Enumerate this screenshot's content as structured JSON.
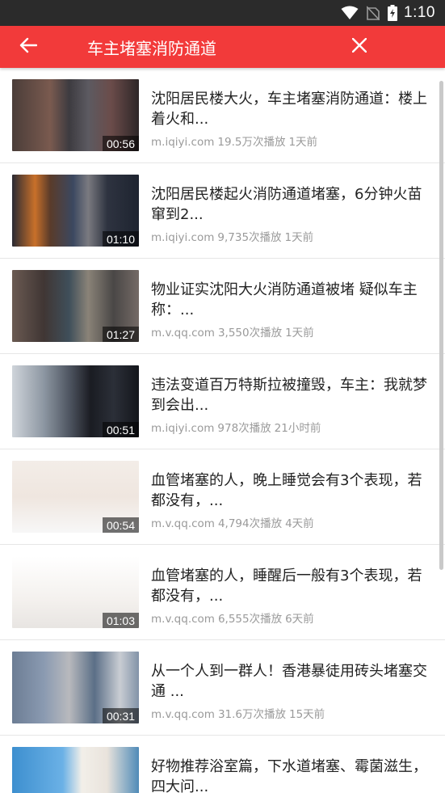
{
  "status_bar": {
    "time": "1:10",
    "icons": [
      "wifi-icon",
      "no-sim-icon",
      "battery-charging-icon"
    ]
  },
  "app_bar": {
    "title": "车主堵塞消防通道",
    "back_icon": "arrow-left-icon",
    "close_icon": "close-icon",
    "color": "#f23a3a"
  },
  "items": [
    {
      "title": "沈阳居民楼大火，车主堵塞消防通道：楼上着火和...",
      "source": "m.iqiyi.com",
      "views": "19.5万次播放",
      "time": "1天前",
      "duration": "00:56"
    },
    {
      "title": "沈阳居民楼起火消防通道堵塞，6分钟火苗窜到2...",
      "source": "m.iqiyi.com",
      "views": "9,735次播放",
      "time": "1天前",
      "duration": "01:10"
    },
    {
      "title": "物业证实沈阳大火消防通道被堵 疑似车主称：...",
      "source": "m.v.qq.com",
      "views": "3,550次播放",
      "time": "1天前",
      "duration": "01:27"
    },
    {
      "title": "违法变道百万特斯拉被撞毁，车主：我就梦到会出...",
      "source": "m.iqiyi.com",
      "views": "978次播放",
      "time": "21小时前",
      "duration": "00:51"
    },
    {
      "title": "血管堵塞的人，晚上睡觉会有3个表现，若都没有，...",
      "source": "m.v.qq.com",
      "views": "4,794次播放",
      "time": "4天前",
      "duration": "00:54"
    },
    {
      "title": "血管堵塞的人，睡醒后一般有3个表现，若都没有，...",
      "source": "m.v.qq.com",
      "views": "6,555次播放",
      "time": "6天前",
      "duration": "01:03"
    },
    {
      "title": "从一个人到一群人！香港暴徒用砖头堵塞交通 ...",
      "source": "m.v.qq.com",
      "views": "31.6万次播放",
      "time": "15天前",
      "duration": "00:31"
    },
    {
      "title": "好物推荐浴室篇，下水道堵塞、霉菌滋生，四大问...",
      "source": "",
      "views": "",
      "time": "",
      "duration": ""
    }
  ]
}
